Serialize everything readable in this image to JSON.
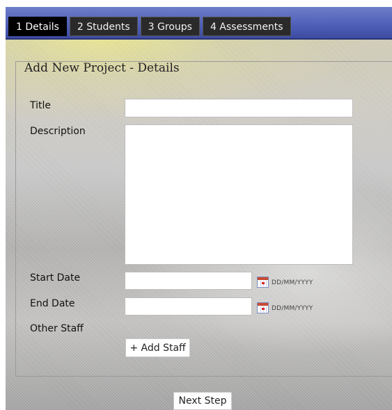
{
  "tabs": [
    {
      "label": "1 Details",
      "active": true
    },
    {
      "label": "2 Students",
      "active": false
    },
    {
      "label": "3 Groups",
      "active": false
    },
    {
      "label": "4 Assessments",
      "active": false
    }
  ],
  "panel": {
    "legend": "Add New Project - Details"
  },
  "form": {
    "title_label": "Title",
    "title_value": "",
    "description_label": "Description",
    "description_value": "",
    "start_date_label": "Start Date",
    "start_date_value": "",
    "end_date_label": "End Date",
    "end_date_value": "",
    "date_format_hint": "DD/MM/YYYY",
    "other_staff_label": "Other Staff",
    "add_staff_label": "+ Add Staff",
    "calendar_icon": "calendar-icon"
  },
  "footer": {
    "next_step_label": "Next Step"
  },
  "colors": {
    "header_blue": "#4f5fb8",
    "tab_active": "#000000",
    "tab_inactive": "#2a2a2a",
    "calendar_red": "#c84a32"
  }
}
